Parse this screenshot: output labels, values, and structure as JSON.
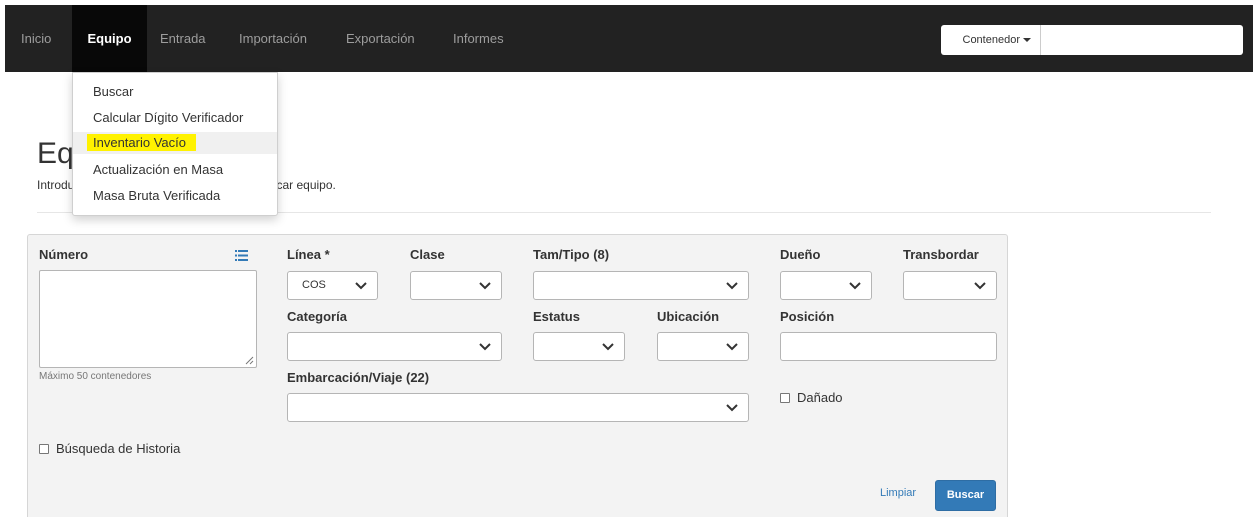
{
  "navbar": {
    "items": [
      {
        "label": "Inicio"
      },
      {
        "label": "Equipo"
      },
      {
        "label": "Entrada"
      },
      {
        "label": "Importación"
      },
      {
        "label": "Exportación"
      },
      {
        "label": "Informes"
      }
    ],
    "active": "Equipo",
    "search": {
      "dropdown_label": "Contenedor",
      "input_value": "",
      "input_placeholder": ""
    }
  },
  "dropdown_menu": {
    "items": [
      {
        "label": "Buscar"
      },
      {
        "label": "Calcular Dígito Verificador"
      },
      {
        "label": "Inventario Vacío",
        "highlighted": true
      },
      {
        "label": "Actualización en Masa"
      },
      {
        "label": "Masa Bruta Verificada"
      }
    ]
  },
  "page": {
    "title": "Equipo",
    "intro": "Introduzca los criterios de búsqueda para ubicar equipo."
  },
  "form": {
    "numero": {
      "label": "Número",
      "value": "",
      "hint": "Máximo 50 contenedores"
    },
    "linea": {
      "label": "Línea *",
      "value": "COS"
    },
    "clase": {
      "label": "Clase",
      "value": ""
    },
    "tam_tipo": {
      "label": "Tam/Tipo (8)",
      "value": ""
    },
    "dueno": {
      "label": "Dueño",
      "value": ""
    },
    "transbordar": {
      "label": "Transbordar",
      "value": ""
    },
    "categoria": {
      "label": "Categoría",
      "value": ""
    },
    "estatus": {
      "label": "Estatus",
      "value": ""
    },
    "ubicacion": {
      "label": "Ubicación",
      "value": ""
    },
    "posicion": {
      "label": "Posición",
      "value": ""
    },
    "embarcacion": {
      "label": "Embarcación/Viaje (22)",
      "value": ""
    },
    "danado": {
      "label": "Dañado",
      "checked": false
    },
    "historia": {
      "label": "Búsqueda de Historia",
      "checked": false
    },
    "clear_label": "Limpiar",
    "search_label": "Buscar"
  },
  "colors": {
    "navbar_bg": "#222222",
    "navbar_active_bg": "#080808",
    "primary": "#337ab7",
    "highlight": "#fff200",
    "panel_bg": "#f3f3f3"
  }
}
